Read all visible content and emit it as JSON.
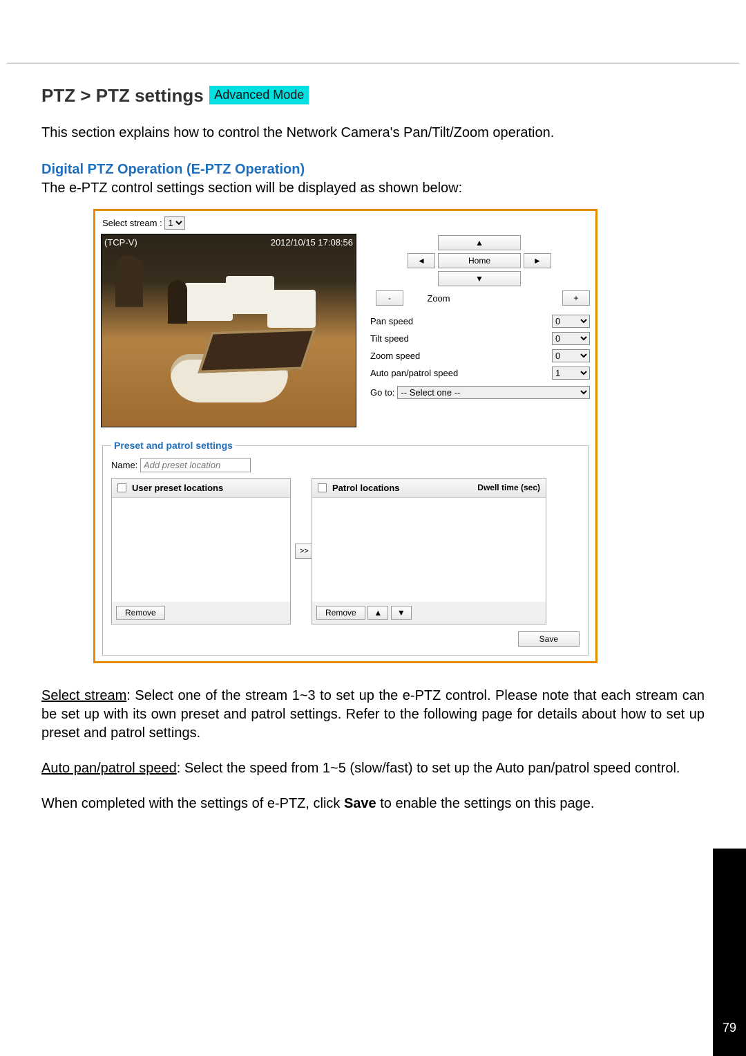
{
  "header": {
    "breadcrumb": "PTZ > PTZ settings",
    "badge": "Advanced Mode"
  },
  "intro": "This section explains how to control the Network Camera's Pan/Tilt/Zoom operation.",
  "section": {
    "title": "Digital PTZ Operation (E-PTZ Operation)",
    "lead": "The e-PTZ control settings section will be displayed as shown below:"
  },
  "panel": {
    "select_stream_label": "Select stream :",
    "select_stream_value": "1",
    "overlay_left": "(TCP-V)",
    "overlay_right": "2012/10/15  17:08:56",
    "home_label": "Home",
    "zoom_label": "Zoom",
    "zoom_minus": "-",
    "zoom_plus": "+",
    "speeds": [
      {
        "label": "Pan speed",
        "value": "0"
      },
      {
        "label": "Tilt speed",
        "value": "0"
      },
      {
        "label": "Zoom speed",
        "value": "0"
      },
      {
        "label": "Auto pan/patrol speed",
        "value": "1"
      }
    ],
    "goto_label": "Go to:",
    "goto_value": "-- Select one --",
    "preset": {
      "legend": "Preset and patrol settings",
      "name_label": "Name:",
      "name_placeholder": "Add preset location",
      "user_locations_header": "User preset locations",
      "patrol_locations_header": "Patrol locations",
      "dwell_header": "Dwell time (sec)",
      "move_label": ">>",
      "remove_label": "Remove",
      "up_label": "▲",
      "down_label": "▼",
      "save_label": "Save"
    }
  },
  "explain": {
    "p1a": "Select stream",
    "p1b": ": Select one of the stream 1~3 to set up the e-PTZ control. Please note that each stream can be set up with its own preset and patrol settings. Refer to the following page for details about how to set up preset and patrol settings.",
    "p2a": "Auto pan/patrol speed",
    "p2b": ": Select the speed from 1~5 (slow/fast) to set up the Auto pan/patrol speed control.",
    "p3a": "When completed with the settings of e-PTZ, click ",
    "p3b": "Save",
    "p3c": " to enable the settings on this page."
  },
  "page_number": "79",
  "glyphs": {
    "up": "▲",
    "down": "▼",
    "left": "◄",
    "right": "►"
  }
}
